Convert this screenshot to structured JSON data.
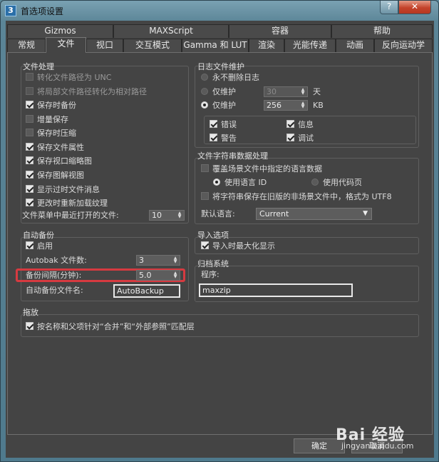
{
  "window": {
    "title": "首选项设置",
    "app_icon": "3"
  },
  "title_buttons": {
    "help": "?",
    "close": "✕"
  },
  "tabs_row1": [
    "Gizmos",
    "MAXScript",
    "容器",
    "帮助"
  ],
  "tabs_row2": [
    "常规",
    "文件",
    "视口",
    "交互模式",
    "Gamma 和 LUT",
    "渲染",
    "光能传递",
    "动画",
    "反向运动学"
  ],
  "active_tab": "文件",
  "file_handling": {
    "label": "文件处理",
    "items": [
      {
        "label": "转化文件路径为 UNC",
        "checked": false,
        "disabled": true
      },
      {
        "label": "将局部文件路径转化为相对路径",
        "checked": false,
        "disabled": true
      },
      {
        "label": "保存时备份",
        "checked": true,
        "disabled": false
      },
      {
        "label": "增量保存",
        "checked": false,
        "disabled": false
      },
      {
        "label": "保存时压缩",
        "checked": false,
        "disabled": false
      },
      {
        "label": "保存文件属性",
        "checked": true,
        "disabled": false
      },
      {
        "label": "保存视口缩略图",
        "checked": true,
        "disabled": false
      },
      {
        "label": "保存图解视图",
        "checked": true,
        "disabled": false
      },
      {
        "label": "显示过时文件消息",
        "checked": true,
        "disabled": false
      },
      {
        "label": "更改时重新加载纹理",
        "checked": true,
        "disabled": false
      }
    ],
    "recent_label": "文件菜单中最近打开的文件:",
    "recent_value": "10"
  },
  "auto_backup": {
    "label": "自动备份",
    "enable_label": "启用",
    "count_label": "Autobak 文件数:",
    "count_value": "3",
    "interval_label": "备份间隔(分钟):",
    "interval_value": "5.0",
    "filename_label": "自动备份文件名:",
    "filename_value": "AutoBackup"
  },
  "drag": {
    "label": "拖放",
    "item": "按名称和父项针对“合并”和“外部参照”匹配层"
  },
  "log": {
    "label": "日志文件维护",
    "never_delete": "永不删除日志",
    "keep_days_label": "仅维护",
    "keep_days_value": "30",
    "days_unit": "天",
    "keep_kb_label": "仅维护",
    "keep_kb_value": "256",
    "kb_unit": "KB",
    "checks": [
      {
        "label": "错误",
        "checked": true
      },
      {
        "label": "信息",
        "checked": true
      },
      {
        "label": "警告",
        "checked": true
      },
      {
        "label": "调试",
        "checked": true
      }
    ]
  },
  "string_data": {
    "label": "文件字符串数据处理",
    "override_label": "覆盖场景文件中指定的语言数据",
    "radio_lang": "使用语言 ID",
    "radio_codepage": "使用代码页",
    "utf8_label": "将字符串保存在旧版的非场景文件中，格式为 UTF8",
    "default_lang_label": "默认语言:",
    "default_lang_value": "Current"
  },
  "import": {
    "label": "导入选项",
    "item": "导入时最大化显示"
  },
  "archive": {
    "label": "归档系统",
    "program_label": "程序:",
    "program_value": "maxzip"
  },
  "footer": {
    "ok": "确定",
    "cancel": "取消"
  },
  "watermark": {
    "brand": "Bai 经验",
    "url": "jingyan.baidu.com"
  }
}
